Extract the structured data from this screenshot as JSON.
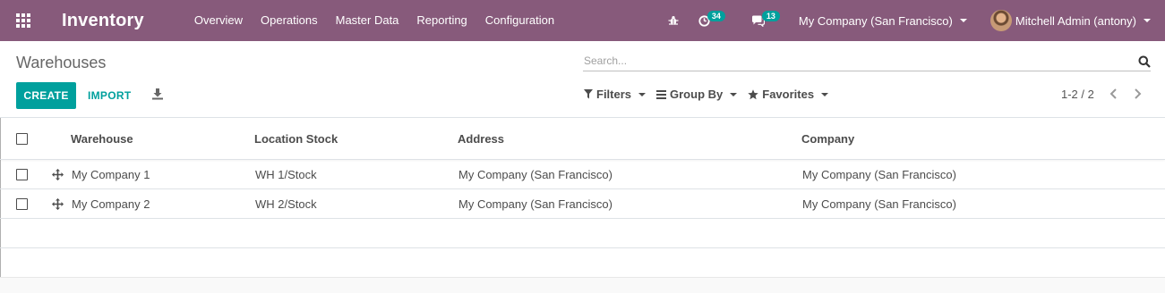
{
  "navbar": {
    "app_title": "Inventory",
    "menu": [
      "Overview",
      "Operations",
      "Master Data",
      "Reporting",
      "Configuration"
    ],
    "activity_count": "34",
    "message_count": "13",
    "company": "My Company (San Francisco)",
    "user": "Mitchell Admin (antony)"
  },
  "control": {
    "breadcrumb": "Warehouses",
    "create_label": "CREATE",
    "import_label": "IMPORT",
    "search_placeholder": "Search...",
    "filters_label": "Filters",
    "groupby_label": "Group By",
    "favorites_label": "Favorites",
    "pager": "1-2 / 2"
  },
  "table": {
    "columns": [
      "Warehouse",
      "Location Stock",
      "Address",
      "Company"
    ],
    "rows": [
      {
        "warehouse": "My Company 1",
        "location_stock": "WH 1/Stock",
        "address": "My Company (San Francisco)",
        "company": "My Company (San Francisco)"
      },
      {
        "warehouse": "My Company 2",
        "location_stock": "WH 2/Stock",
        "address": "My Company (San Francisco)",
        "company": "My Company (San Francisco)"
      }
    ]
  },
  "colors": {
    "navbar": "#875a7b",
    "primary": "#00a09d",
    "badge": "#00a09d"
  },
  "icons": [
    "apps-grid-icon",
    "bug-icon",
    "clock-icon",
    "comments-icon",
    "download-icon",
    "search-icon",
    "filter-icon",
    "bars-icon",
    "star-icon",
    "chevron-left-icon",
    "chevron-right-icon",
    "move-handle-icon"
  ]
}
